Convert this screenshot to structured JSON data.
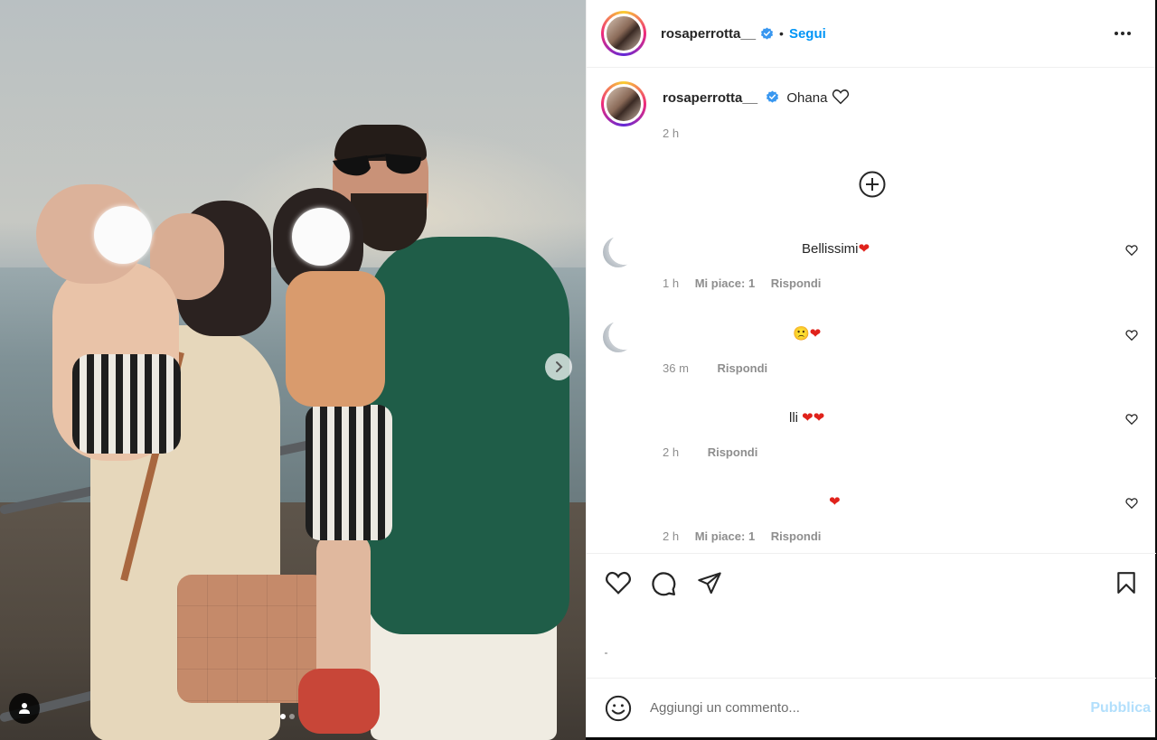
{
  "post": {
    "username": "rosaperrotta__",
    "follow_separator": "•",
    "follow_label": "Segui",
    "caption": "Ohana",
    "caption_time": "2 h",
    "carousel": {
      "current": 1,
      "total": 2
    }
  },
  "comments": [
    {
      "text": "Bellissimi",
      "emoji": "❤",
      "time": "1 h",
      "likes": "Mi piace: 1",
      "reply": "Rispondi"
    },
    {
      "text": "",
      "emoji": "🙁❤",
      "time": "36 m",
      "likes": "",
      "reply": "Rispondi"
    },
    {
      "text": "lli",
      "emoji": "❤❤",
      "time": "2 h",
      "likes": "",
      "reply": "Rispondi"
    },
    {
      "text": "",
      "emoji": "❤",
      "time": "2 h",
      "likes": "Mi piace: 1",
      "reply": "Rispondi"
    }
  ],
  "add_comment": {
    "placeholder": "Aggiungi un commento...",
    "publish_label": "Pubblica"
  },
  "colors": {
    "accent": "#0095f6",
    "publish_disabled": "#b2dffc",
    "heart": "#e0221b",
    "verified": "#3897f0"
  },
  "icons": [
    "verified-icon",
    "more-options-icon",
    "plus-circle-icon",
    "heart-icon",
    "comment-icon",
    "share-icon",
    "bookmark-icon",
    "emoji-icon",
    "user-tag-icon",
    "chevron-right-icon"
  ]
}
